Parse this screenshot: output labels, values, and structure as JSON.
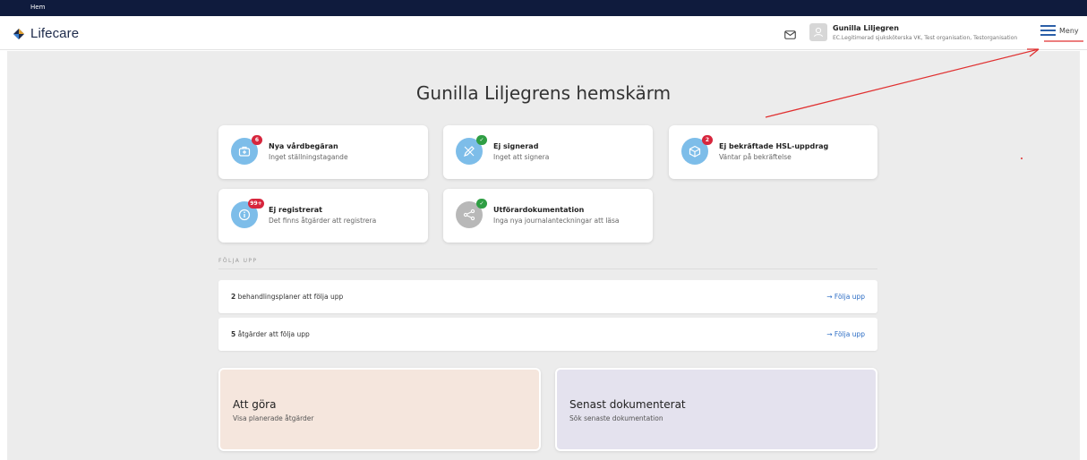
{
  "topbar": {
    "label": "Hem"
  },
  "header": {
    "logo_text": "Lifecare",
    "user_name": "Gunilla Liljegren",
    "user_role": "EC.Legitimerad sjuksköterska VK, Test organisation, Testorganisation",
    "menu_label": "Meny",
    "icons": [
      "mail-icon",
      "avatar-icon",
      "hamburger-icon"
    ]
  },
  "page": {
    "title": "Gunilla Liljegrens hemskärm"
  },
  "cards": [
    {
      "title": "Nya vårdbegäran",
      "subtitle": "Inget ställningstagande",
      "badge": "6",
      "badge_color": "#d7263d",
      "icon": "medical-bag-icon"
    },
    {
      "title": "Ej signerad",
      "subtitle": "Inget att signera",
      "badge": "✓",
      "badge_color": "#2f9e44",
      "icon": "pen-icon"
    },
    {
      "title": "Ej bekräftade HSL-uppdrag",
      "subtitle": "Väntar på bekräftelse",
      "badge": "2",
      "badge_color": "#d7263d",
      "icon": "box-icon"
    },
    {
      "title": "Ej registrerat",
      "subtitle": "Det finns åtgärder att registrera",
      "badge": "99+",
      "badge_color": "#d7263d",
      "icon": "info-icon"
    },
    {
      "title": "Utförardokumentation",
      "subtitle": "Inga nya journalanteckningar att läsa",
      "badge": "✓",
      "badge_color": "#2f9e44",
      "icon": "share-icon"
    }
  ],
  "follow_up": {
    "section_label": "FÖLJA UPP",
    "rows": [
      {
        "count": "2",
        "text": " behandlingsplaner att följa upp",
        "link": "→  Följa upp"
      },
      {
        "count": "5",
        "text": " åtgärder att följa upp",
        "link": "→  Följa upp"
      }
    ]
  },
  "bottom_cards": [
    {
      "title": "Att göra",
      "subtitle": "Visa planerade åtgärder",
      "color": "#f5e6dd"
    },
    {
      "title": "Senast dokumenterat",
      "subtitle": "Sök senaste dokumentation",
      "color": "#e4e2ee"
    }
  ],
  "colors": {
    "topbar": "#0f1b3d",
    "accent": "#2b6cc4",
    "icon_blue": "#7dbde9",
    "annotation": "#e03030"
  }
}
